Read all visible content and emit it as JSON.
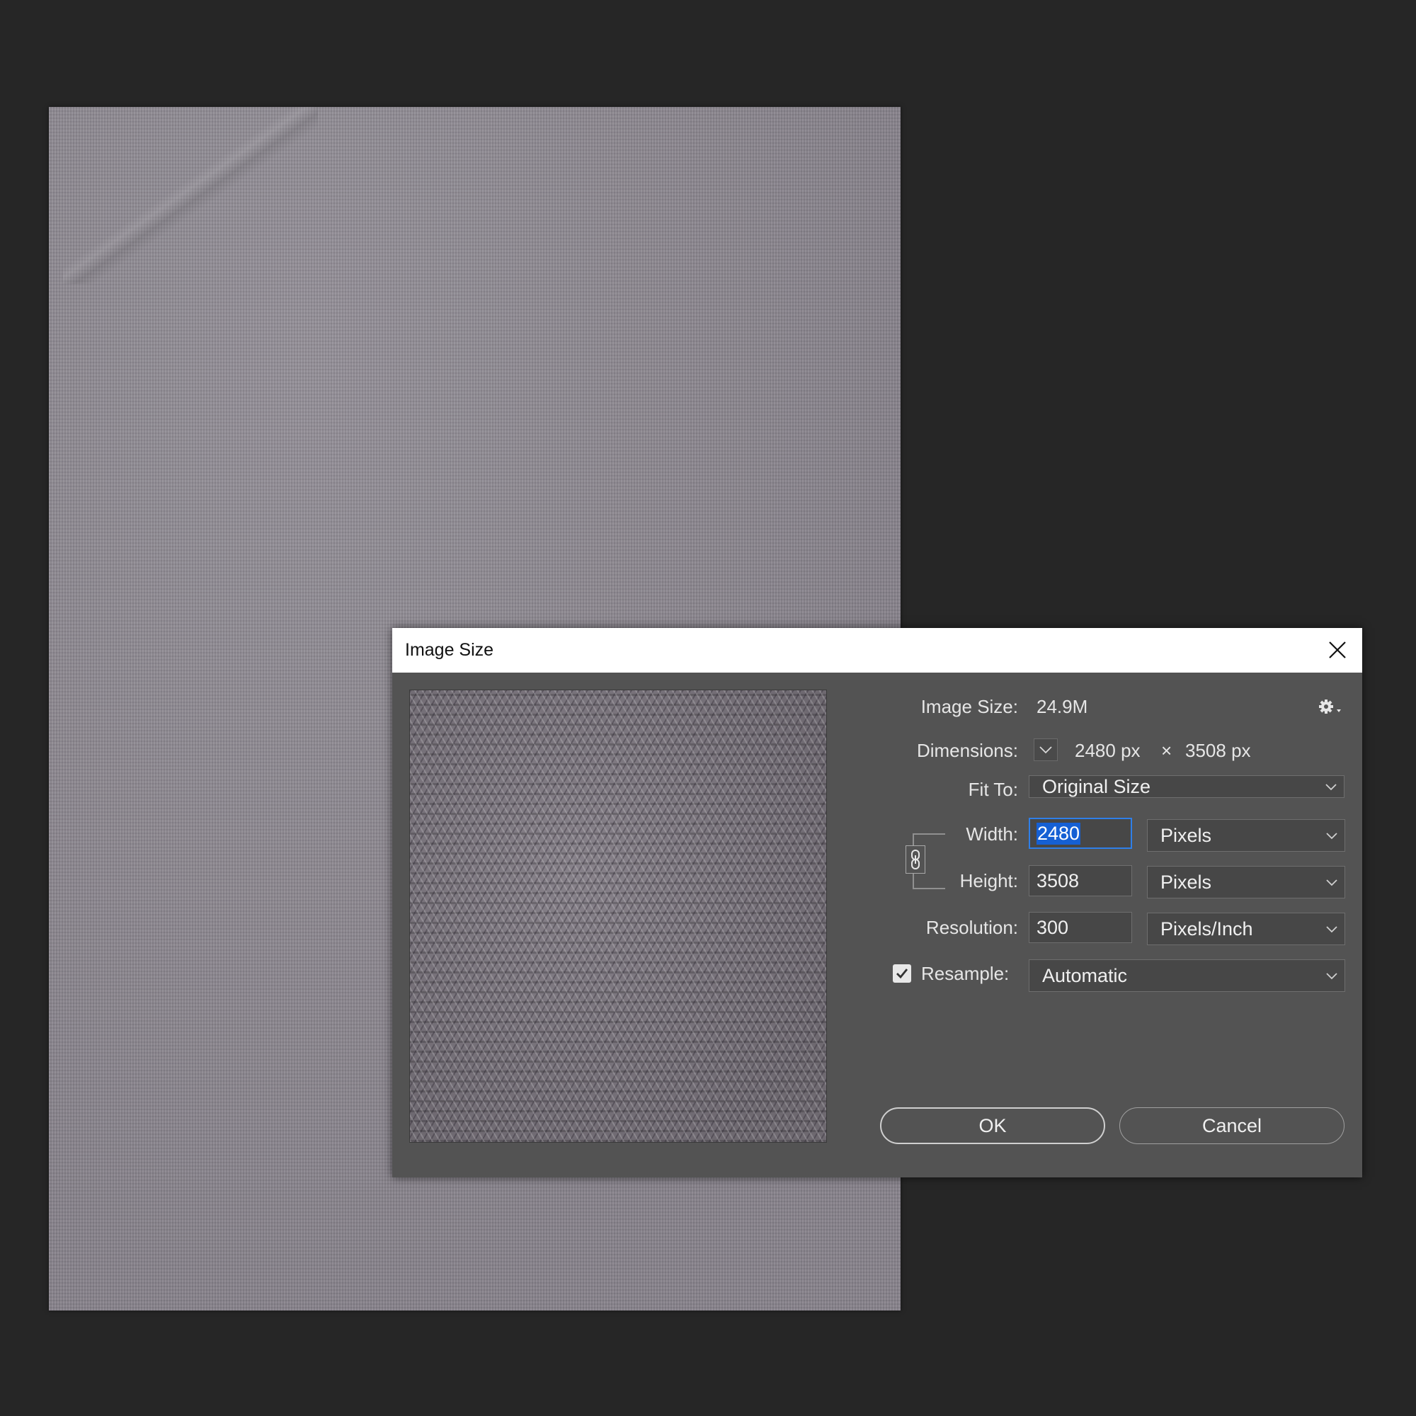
{
  "dialog": {
    "title": "Image Size",
    "image_size_label": "Image Size:",
    "image_size_value": "24.9M",
    "dimensions_label": "Dimensions:",
    "dimensions_width": "2480 px",
    "dimensions_sep": "×",
    "dimensions_height": "3508 px",
    "fit_to_label": "Fit To:",
    "fit_to_value": "Original Size",
    "width_label": "Width:",
    "width_value": "2480",
    "width_unit": "Pixels",
    "height_label": "Height:",
    "height_value": "3508",
    "height_unit": "Pixels",
    "resolution_label": "Resolution:",
    "resolution_value": "300",
    "resolution_unit": "Pixels/Inch",
    "resample_label": "Resample:",
    "resample_checked": true,
    "resample_value": "Automatic",
    "ok_label": "OK",
    "cancel_label": "Cancel"
  },
  "icons": {
    "close": "close-icon",
    "gear": "gear-icon",
    "dimensions_toggle": "chevron-down-icon",
    "constrain": "link-icon",
    "checkbox": "checkmark-icon",
    "dropdown": "chevron-down-icon"
  },
  "colors": {
    "app_background": "#262626",
    "dialog_background": "#535353",
    "title_bar": "#ffffff",
    "focus_accent": "#2f7fe8",
    "selection_highlight": "#1560d4"
  }
}
